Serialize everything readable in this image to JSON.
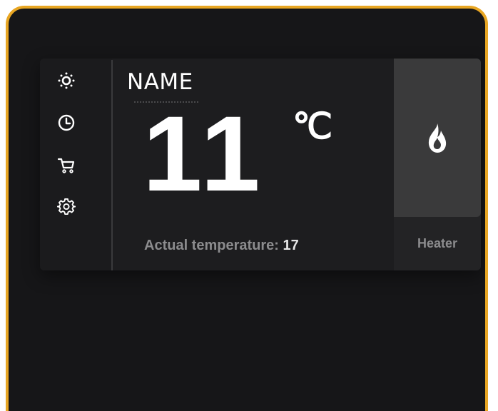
{
  "device": {
    "name": "NAME",
    "set_temperature": "11",
    "unit": "℃",
    "actual_label": "Actual temperature:",
    "actual_value": "17",
    "mode_label": "Heater"
  },
  "sidebar": {
    "items": [
      {
        "icon": "sun-icon"
      },
      {
        "icon": "clock-icon"
      },
      {
        "icon": "cart-icon"
      },
      {
        "icon": "gear-icon"
      }
    ]
  },
  "mode_icon": "flame-icon",
  "colors": {
    "frame_border": "#e8a623",
    "background": "#161618",
    "panel": "#1d1d1f",
    "heater_active": "#3a3a3b",
    "text_primary": "#ffffff",
    "text_secondary": "#8c8c8e"
  }
}
